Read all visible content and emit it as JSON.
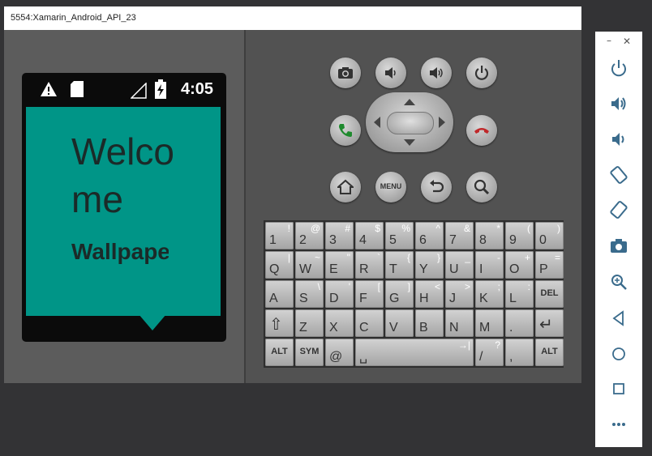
{
  "window": {
    "title": "5554:Xamarin_Android_API_23"
  },
  "status_bar": {
    "time": "4:05"
  },
  "app": {
    "welcome_text": "Welcome",
    "subtitle_text": "Wallpapers"
  },
  "colors": {
    "app_background": "#009587",
    "window_frame": "#4a4a4a"
  },
  "controls": {
    "top_row": [
      "camera-icon",
      "volume-down-icon",
      "volume-up-icon",
      "power-icon"
    ],
    "call_row": [
      "call-icon",
      "dpad",
      "end-call-icon"
    ],
    "bottom_row": [
      "home-icon",
      "menu-button",
      "back-icon",
      "search-icon"
    ],
    "menu_label": "MENU"
  },
  "keyboard": {
    "rows": [
      [
        {
          "m": "1",
          "s": "!"
        },
        {
          "m": "2",
          "s": "@"
        },
        {
          "m": "3",
          "s": "#"
        },
        {
          "m": "4",
          "s": "$"
        },
        {
          "m": "5",
          "s": "%"
        },
        {
          "m": "6",
          "s": "^"
        },
        {
          "m": "7",
          "s": "&"
        },
        {
          "m": "8",
          "s": "*"
        },
        {
          "m": "9",
          "s": "("
        },
        {
          "m": "0",
          "s": ")"
        }
      ],
      [
        {
          "m": "Q",
          "s": "|"
        },
        {
          "m": "W",
          "s": "~"
        },
        {
          "m": "E",
          "s": "\""
        },
        {
          "m": "R",
          "s": "`"
        },
        {
          "m": "T",
          "s": "{"
        },
        {
          "m": "Y",
          "s": "}"
        },
        {
          "m": "U",
          "s": "_"
        },
        {
          "m": "I",
          "s": "-"
        },
        {
          "m": "O",
          "s": "+"
        },
        {
          "m": "P",
          "s": "="
        }
      ],
      [
        {
          "m": "A",
          "s": ""
        },
        {
          "m": "S",
          "s": "\\"
        },
        {
          "m": "D",
          "s": "'"
        },
        {
          "m": "F",
          "s": "["
        },
        {
          "m": "G",
          "s": "]"
        },
        {
          "m": "H",
          "s": "<"
        },
        {
          "m": "J",
          "s": ">"
        },
        {
          "m": "K",
          "s": ";"
        },
        {
          "m": "L",
          "s": ":"
        },
        {
          "m": "DEL",
          "s": ""
        }
      ],
      [
        {
          "m": "⇧",
          "s": ""
        },
        {
          "m": "Z",
          "s": ""
        },
        {
          "m": "X",
          "s": ""
        },
        {
          "m": "C",
          "s": ""
        },
        {
          "m": "V",
          "s": ""
        },
        {
          "m": "B",
          "s": ""
        },
        {
          "m": "N",
          "s": ""
        },
        {
          "m": "M",
          "s": ""
        },
        {
          "m": ".",
          "s": ""
        },
        {
          "m": "↵",
          "s": ""
        }
      ],
      [
        {
          "m": "ALT",
          "s": ""
        },
        {
          "m": "SYM",
          "s": ""
        },
        {
          "m": "@",
          "s": ""
        },
        {
          "m": "␣",
          "s": "→|"
        },
        {
          "m": "/",
          "s": "?"
        },
        {
          "m": ",",
          "s": ""
        },
        {
          "m": "ALT",
          "s": ""
        }
      ]
    ]
  },
  "sidebar": {
    "window_controls": [
      "minimize-icon",
      "close-icon"
    ],
    "items": [
      "power-icon",
      "volume-up-icon",
      "volume-down-icon",
      "rotate-left-icon",
      "rotate-right-icon",
      "screenshot-icon",
      "zoom-icon",
      "back-icon",
      "home-icon",
      "overview-icon",
      "more-icon"
    ]
  }
}
